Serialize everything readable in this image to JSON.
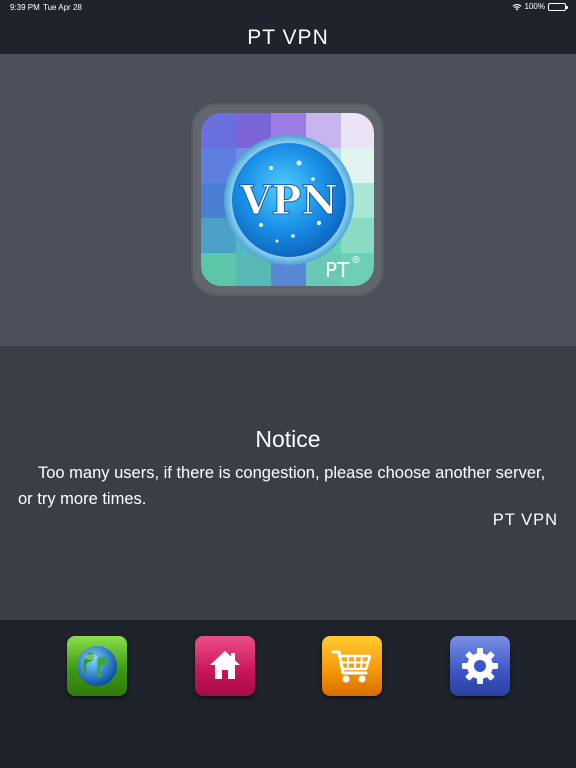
{
  "status_bar": {
    "time": "9:39 PM",
    "date": "Tue Apr 28",
    "battery": "100%",
    "wifi_icon": "wifi-icon",
    "battery_icon": "battery-icon"
  },
  "header": {
    "title": "PT  VPN"
  },
  "logo": {
    "text": "VPN",
    "brand": "PT",
    "mark": "®"
  },
  "notice": {
    "title": "Notice",
    "body": "Too many users, if there is congestion, please choose another server, or try more times.",
    "signature": "PT  VPN"
  },
  "toolbar": {
    "items": [
      {
        "icon": "globe-icon",
        "color": "#3f9a14"
      },
      {
        "icon": "home-icon",
        "color": "#c8145a"
      },
      {
        "icon": "shopping-cart-icon",
        "color": "#f59a0a"
      },
      {
        "icon": "gear-icon",
        "color": "#3b55c4"
      }
    ]
  },
  "colors": {
    "header_bg": "#1f232c",
    "hero_bg": "#4b505a",
    "notice_bg": "#3a3e47",
    "toolbar_bg": "#1e222b"
  }
}
